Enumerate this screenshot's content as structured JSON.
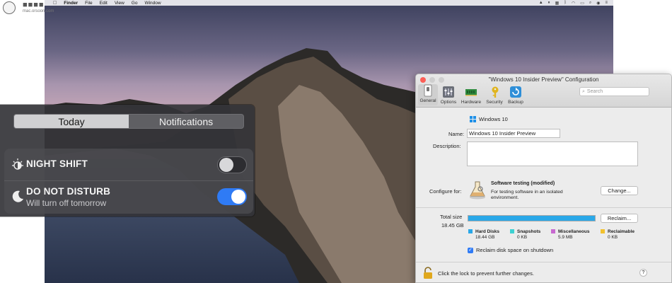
{
  "menubar": {
    "app": "Finder",
    "items": [
      "File",
      "Edit",
      "View",
      "Go",
      "Window"
    ],
    "status_icons": [
      "airplay-icon",
      "parallels-icon",
      "flag-icon",
      "bluetooth-icon",
      "wifi-icon",
      "battery-icon",
      "search-icon",
      "control-icon",
      "menu-icon"
    ]
  },
  "watermark": {
    "line2": "mac.orsoon.com"
  },
  "notification_center": {
    "tabs": [
      "Today",
      "Notifications"
    ],
    "active_tab": "Today",
    "night_shift": {
      "label": "NIGHT SHIFT",
      "on": false
    },
    "do_not_disturb": {
      "label": "DO NOT DISTURB",
      "sub": "Will turn off tomorrow",
      "on": true
    },
    "toggle_on_color": "#2f7bf5"
  },
  "config": {
    "title": "\"Windows 10 Insider Preview\" Configuration",
    "toolbar": [
      {
        "label": "General",
        "icon": "switch-icon"
      },
      {
        "label": "Options",
        "icon": "options-icon"
      },
      {
        "label": "Hardware",
        "icon": "chip-icon"
      },
      {
        "label": "Security",
        "icon": "key-icon"
      },
      {
        "label": "Backup",
        "icon": "backup-icon"
      }
    ],
    "search_placeholder": "Search",
    "os_name": "Windows 10",
    "name_label": "Name:",
    "name_value": "Windows 10 Insider Preview",
    "description_label": "Description:",
    "description_value": "",
    "configure_label": "Configure for:",
    "profile_title": "Software testing (modified)",
    "profile_desc": "For testing software in an isolated environment.",
    "change_button": "Change...",
    "total_size_label": "Total size",
    "total_size_value": "18.45 GB",
    "reclaim_button": "Reclaim...",
    "usage_fraction": 1.0,
    "usage_color": "#2aa8e8",
    "legend": [
      {
        "name": "Hard Disks",
        "value": "18.44 GB",
        "color": "#2aa8e8"
      },
      {
        "name": "Snapshots",
        "value": "0 KB",
        "color": "#3dd1d1"
      },
      {
        "name": "Miscellaneous",
        "value": "5.9 MB",
        "color": "#c86ad0"
      },
      {
        "name": "Reclaimable",
        "value": "0 KB",
        "color": "#f2c12e"
      }
    ],
    "reclaim_checkbox": {
      "label": "Reclaim disk space on shutdown",
      "checked": true
    },
    "lock_text": "Click the lock to prevent further changes.",
    "help": "?"
  }
}
